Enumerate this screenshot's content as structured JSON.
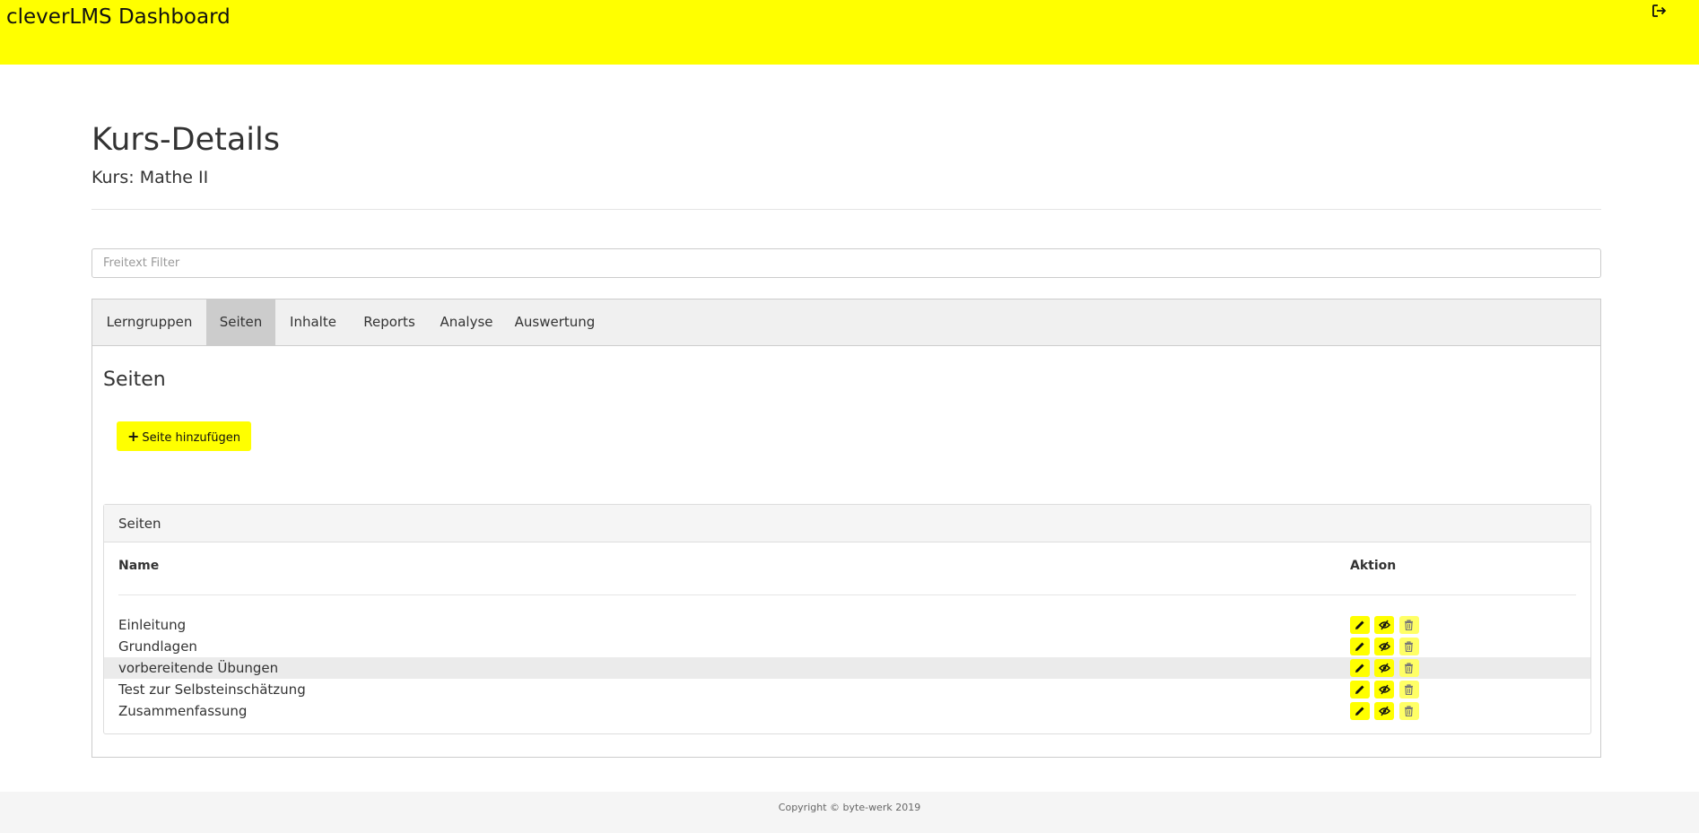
{
  "app": {
    "title": "cleverLMS Dashboard",
    "logout_icon": "logout-icon"
  },
  "page": {
    "title": "Kurs-Details",
    "subtitle": "Kurs: Mathe II"
  },
  "filter": {
    "placeholder": "Freitext Filter",
    "value": ""
  },
  "tabs": [
    {
      "label": "Lerngruppen",
      "active": false
    },
    {
      "label": "Seiten",
      "active": true
    },
    {
      "label": "Inhalte",
      "active": false
    },
    {
      "label": "Reports",
      "active": false
    },
    {
      "label": "Analyse",
      "active": false
    },
    {
      "label": "Auswertung",
      "active": false
    }
  ],
  "section": {
    "title": "Seiten",
    "add_button_label": "Seite hinzufügen",
    "add_button_icon": "plus-icon"
  },
  "table": {
    "card_title": "Seiten",
    "columns": [
      "Name",
      "Aktion"
    ],
    "rows": [
      {
        "name": "Einleitung"
      },
      {
        "name": "Grundlagen"
      },
      {
        "name": "vorbereitende Übungen"
      },
      {
        "name": "Test zur Selbsteinschätzung"
      },
      {
        "name": "Zusammenfassung"
      }
    ],
    "action_icons": [
      "pencil-icon",
      "eye-slash-icon",
      "trash-icon"
    ]
  },
  "footer": {
    "copyright": "Copyright © byte-werk 2019"
  },
  "colors": {
    "accent": "#ffff00",
    "tab_active": "#cccccc",
    "row_highlight": "#ebebeb"
  }
}
